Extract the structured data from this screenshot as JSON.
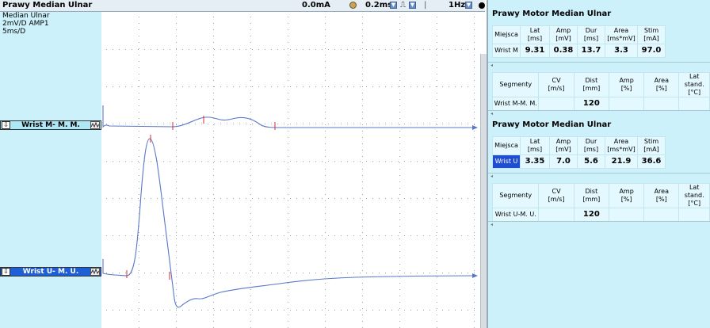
{
  "toolbar": {
    "title": "Prawy Median Ulnar",
    "stim_current": "0.0mA",
    "sweep_speed": "0.2ms",
    "filter": "1Hz"
  },
  "left_panel": {
    "info_lines": [
      "Median Ulnar",
      "2mV/D  AMP1",
      "5ms/D"
    ],
    "traces": [
      {
        "label": "Wrist M- M. M."
      },
      {
        "label": "Wrist U- M. U."
      }
    ]
  },
  "right_panel": {
    "sections": [
      {
        "title": "Prawy Motor Median Ulnar",
        "motor_headers": [
          "Miejsca",
          "Lat\n[ms]",
          "Amp\n[mV]",
          "Dur\n[ms]",
          "Area\n[ms*mV]",
          "Stim\n[mA]"
        ],
        "motor_row": [
          "Wrist M",
          "9.31",
          "0.38",
          "13.7",
          "3.3",
          "97.0"
        ],
        "segment_headers": [
          "Segmenty",
          "CV\n[m/s]",
          "Dist\n[mm]",
          "Amp\n[%]",
          "Area\n[%]",
          "Lat stand.\n[°C]"
        ],
        "segment_row": [
          "Wrist M-M. M.",
          "",
          "120",
          "",
          "",
          ""
        ]
      },
      {
        "title": "Prawy Motor Median Ulnar",
        "motor_headers": [
          "Miejsca",
          "Lat\n[ms]",
          "Amp\n[mV]",
          "Dur\n[ms]",
          "Area\n[ms*mV]",
          "Stim\n[mA]"
        ],
        "motor_row": [
          "Wrist U",
          "3.35",
          "7.0",
          "5.6",
          "21.9",
          "36.6"
        ],
        "segment_headers": [
          "Segmenty",
          "CV\n[m/s]",
          "Dist\n[mm]",
          "Amp\n[%]",
          "Area\n[%]",
          "Lat stand.\n[°C]"
        ],
        "segment_row": [
          "Wrist U-M. U.",
          "",
          "120",
          "",
          "",
          ""
        ]
      }
    ]
  },
  "colors": {
    "panel_bg": "#cdf1fb",
    "trace": "#5a78c8",
    "marker": "#d8282e",
    "selected": "#1f4fd0"
  }
}
